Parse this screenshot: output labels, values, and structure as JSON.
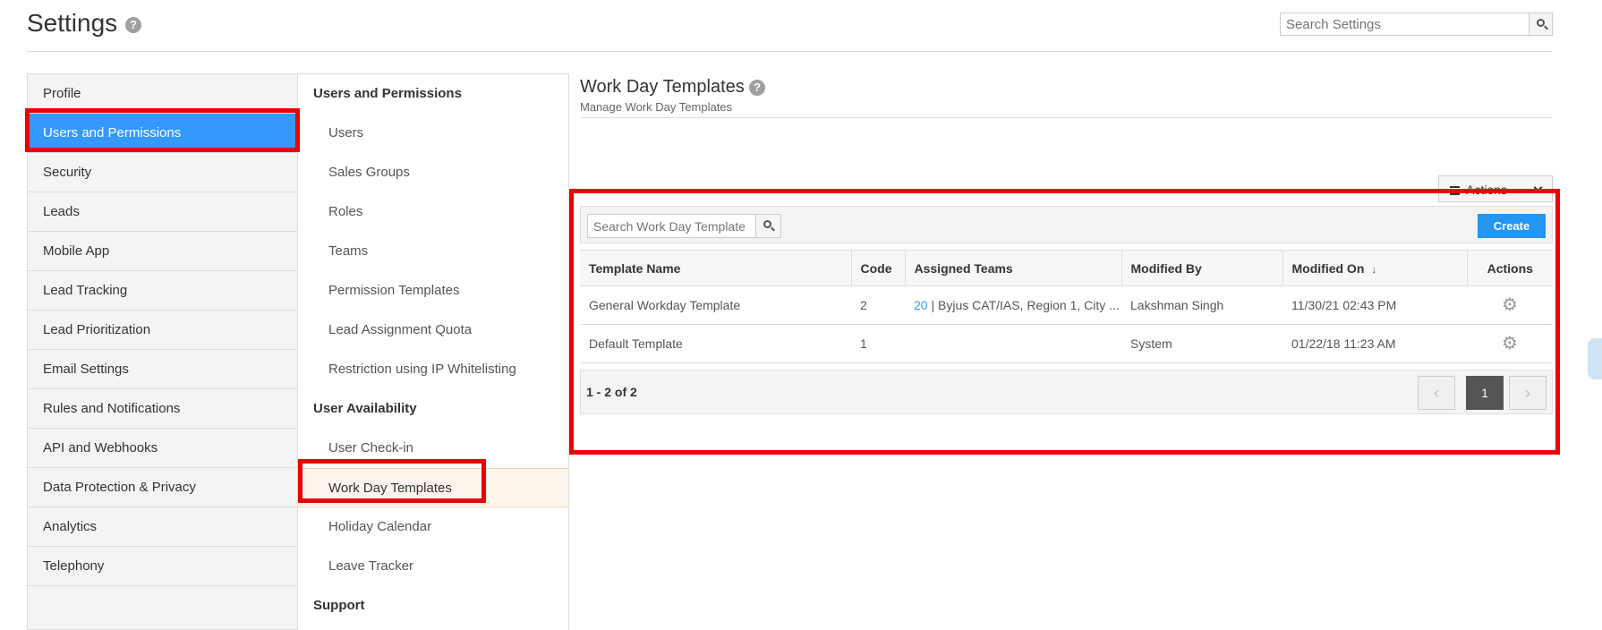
{
  "header": {
    "title": "Settings",
    "help_icon": "?",
    "search_placeholder": "Search Settings"
  },
  "left_nav": {
    "items": [
      {
        "label": "Profile"
      },
      {
        "label": "Users and Permissions",
        "active": true
      },
      {
        "label": "Security"
      },
      {
        "label": "Leads"
      },
      {
        "label": "Mobile App"
      },
      {
        "label": "Lead Tracking"
      },
      {
        "label": "Lead Prioritization"
      },
      {
        "label": "Email Settings"
      },
      {
        "label": "Rules and Notifications"
      },
      {
        "label": "API and Webhooks"
      },
      {
        "label": "Data Protection & Privacy"
      },
      {
        "label": "Analytics"
      },
      {
        "label": "Telephony"
      }
    ]
  },
  "mid_nav": {
    "group_users": "Users and Permissions",
    "users_items": [
      "Users",
      "Sales Groups",
      "Roles",
      "Teams",
      "Permission Templates",
      "Lead Assignment Quota",
      "Restriction using IP Whitelisting"
    ],
    "group_availability": "User Availability",
    "availability_items": [
      "User Check-in",
      "Work Day Templates",
      "Holiday Calendar",
      "Leave Tracker"
    ],
    "active_item": "Work Day Templates",
    "group_support": "Support"
  },
  "content": {
    "title": "Work Day Templates",
    "subtitle": "Manage Work Day Templates",
    "actions_label": "Actions",
    "search_placeholder": "Search Work Day Template",
    "create_label": "Create",
    "columns": [
      "Template Name",
      "Code",
      "Assigned Teams",
      "Modified By",
      "Modified On",
      "Actions"
    ],
    "sort_indicator": "↓",
    "rows": [
      {
        "name": "General Workday Template",
        "code": "2",
        "teams_count": "20",
        "teams_text": " | Byjus CAT/IAS, Region 1, City ...",
        "modified_by": "Lakshman Singh",
        "modified_on": "11/30/21 02:43 PM"
      },
      {
        "name": "Default Template",
        "code": "1",
        "teams_count": "",
        "teams_text": "",
        "modified_by": "System",
        "modified_on": "01/22/18 11:23 AM"
      }
    ],
    "pager_info": "1 - 2 of 2",
    "current_page": "1",
    "prev_glyph": "‹",
    "next_glyph": "›",
    "gear_glyph": "⚙"
  },
  "colors": {
    "accent": "#3399ff",
    "create_button": "#2196f3",
    "highlight": "#ee0000"
  }
}
